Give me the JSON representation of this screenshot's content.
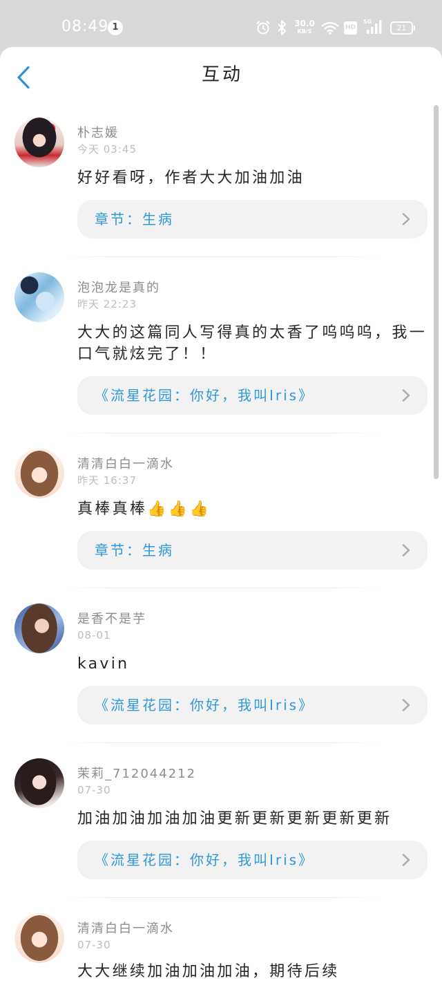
{
  "status_bar": {
    "time": "08:49",
    "notification_count": "1",
    "net_speed_value": "30.0",
    "net_speed_unit": "KB/S",
    "hd_label": "HD",
    "network_label": "5G",
    "battery_level": "21",
    "icons": [
      "alarm-icon",
      "bluetooth-icon",
      "wifi-icon",
      "hd-icon",
      "signal-icon",
      "battery-icon"
    ]
  },
  "header": {
    "title": "互动",
    "back_icon": "chevron-left-icon"
  },
  "comments": [
    {
      "name": "朴志媛",
      "time": "今天 03:45",
      "text": "好好看呀，作者大大加油加油",
      "link": "章节：生病",
      "link_icon": "chevron-right-icon"
    },
    {
      "name": "泡泡龙是真的",
      "time": "昨天 22:23",
      "text": "大大的这篇同人写得真的太香了呜呜呜，我一口气就炫完了！！",
      "link": "《流星花园：你好，我叫Iris》",
      "link_icon": "chevron-right-icon"
    },
    {
      "name": "清清白白一滴水",
      "time": "昨天 16:37",
      "text": "真棒真棒👍👍👍",
      "link": "章节：生病",
      "link_icon": "chevron-right-icon"
    },
    {
      "name": "是香不是芋",
      "time": "08-01",
      "text": "kavin",
      "link": "《流星花园：你好，我叫Iris》",
      "link_icon": "chevron-right-icon"
    },
    {
      "name": "茉莉_712044212",
      "time": "07-30",
      "text": "加油加油加油加油更新更新更新更新更新",
      "link": "《流星花园：你好，我叫Iris》",
      "link_icon": "chevron-right-icon"
    },
    {
      "name": "清清白白一滴水",
      "time": "07-30",
      "text": "大大继续加油加油加油，期待后续"
    }
  ],
  "colors": {
    "status_bar_bg": "#d9d9d9",
    "accent": "#2e98d9",
    "back_icon": "#2d8fdb",
    "link_bg": "#f2f2f2",
    "text": "#262626",
    "name": "#8c8c8c",
    "time": "#bdbdbd"
  }
}
